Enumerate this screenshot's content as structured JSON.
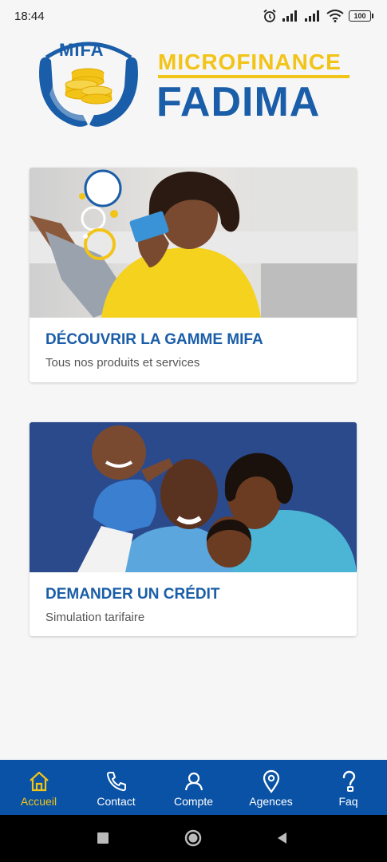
{
  "status_bar": {
    "time": "18:44",
    "battery": "100",
    "icons": [
      "alarm-icon",
      "signal-icon",
      "signal-icon",
      "wifi-icon",
      "battery-icon"
    ]
  },
  "logo": {
    "mark_text": "MIFA",
    "line1": "MICROFINANCE",
    "line2": "FADIMA",
    "colors": {
      "blue": "#1a5da8",
      "gold": "#f2c418"
    }
  },
  "cards": [
    {
      "title": "DÉCOUVRIR LA GAMME MIFA",
      "subtitle": "Tous nos produits et services",
      "image": "woman-with-card-photo"
    },
    {
      "title": "DEMANDER UN CRÉDIT",
      "subtitle": "Simulation tarifaire",
      "image": "family-photo"
    }
  ],
  "bottom_nav": {
    "active": "Accueil",
    "items": [
      {
        "label": "Accueil",
        "icon": "home-icon"
      },
      {
        "label": "Contact",
        "icon": "phone-icon"
      },
      {
        "label": "Compte",
        "icon": "user-icon"
      },
      {
        "label": "Agences",
        "icon": "location-pin-icon"
      },
      {
        "label": "Faq",
        "icon": "question-icon"
      }
    ],
    "colors": {
      "background": "#0a52a5",
      "active": "#f2c418",
      "inactive": "#ffffff"
    }
  },
  "system_nav": {
    "buttons": [
      "recents-button",
      "home-button",
      "back-button"
    ]
  }
}
